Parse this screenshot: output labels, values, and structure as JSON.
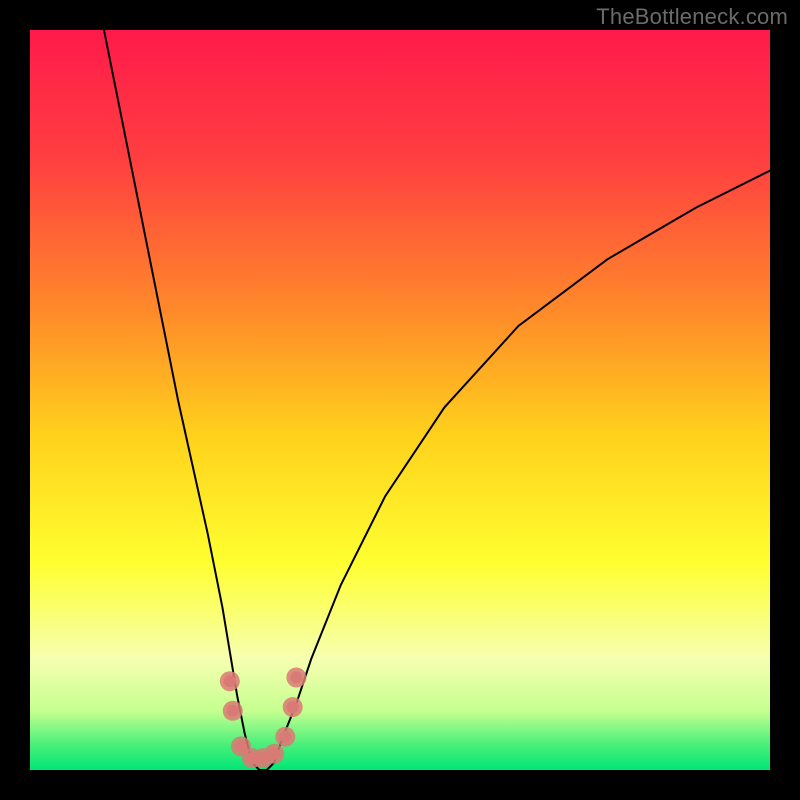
{
  "watermark": "TheBottleneck.com",
  "chart_data": {
    "type": "line",
    "title": "",
    "xlabel": "",
    "ylabel": "",
    "xlim": [
      0,
      100
    ],
    "ylim": [
      0,
      100
    ],
    "background_gradient": {
      "stops": [
        {
          "offset": 0.0,
          "color": "#ff1a4b"
        },
        {
          "offset": 0.18,
          "color": "#ff4040"
        },
        {
          "offset": 0.38,
          "color": "#ff8a2a"
        },
        {
          "offset": 0.55,
          "color": "#ffd21c"
        },
        {
          "offset": 0.72,
          "color": "#ffff30"
        },
        {
          "offset": 0.85,
          "color": "#f6ffb0"
        },
        {
          "offset": 0.92,
          "color": "#c6ff90"
        },
        {
          "offset": 0.965,
          "color": "#4cf07a"
        },
        {
          "offset": 1.0,
          "color": "#00e676"
        }
      ]
    },
    "series": [
      {
        "name": "bottleneck-curve",
        "stroke": "#000000",
        "stroke_width": 2,
        "x": [
          10,
          12,
          14,
          16,
          18,
          20,
          22,
          24,
          26,
          27,
          28,
          29,
          30,
          31,
          32,
          33,
          34,
          36,
          38,
          42,
          48,
          56,
          66,
          78,
          90,
          100
        ],
        "values": [
          100,
          90,
          80,
          70,
          60,
          50,
          41,
          32,
          22,
          16,
          10,
          5,
          1,
          0,
          0,
          1,
          4,
          9,
          15,
          25,
          37,
          49,
          60,
          69,
          76,
          81
        ]
      }
    ],
    "markers": {
      "name": "minimum-trough-markers",
      "color": "#d97a74",
      "radius_outer": 10,
      "radius_inner": 6,
      "points": [
        {
          "x": 27.0,
          "y": 12.0
        },
        {
          "x": 27.4,
          "y": 8.0
        },
        {
          "x": 28.5,
          "y": 3.2
        },
        {
          "x": 30.0,
          "y": 1.6
        },
        {
          "x": 31.5,
          "y": 1.6
        },
        {
          "x": 33.0,
          "y": 2.2
        },
        {
          "x": 34.5,
          "y": 4.5
        },
        {
          "x": 35.5,
          "y": 8.5
        },
        {
          "x": 36.0,
          "y": 12.5
        }
      ]
    }
  }
}
